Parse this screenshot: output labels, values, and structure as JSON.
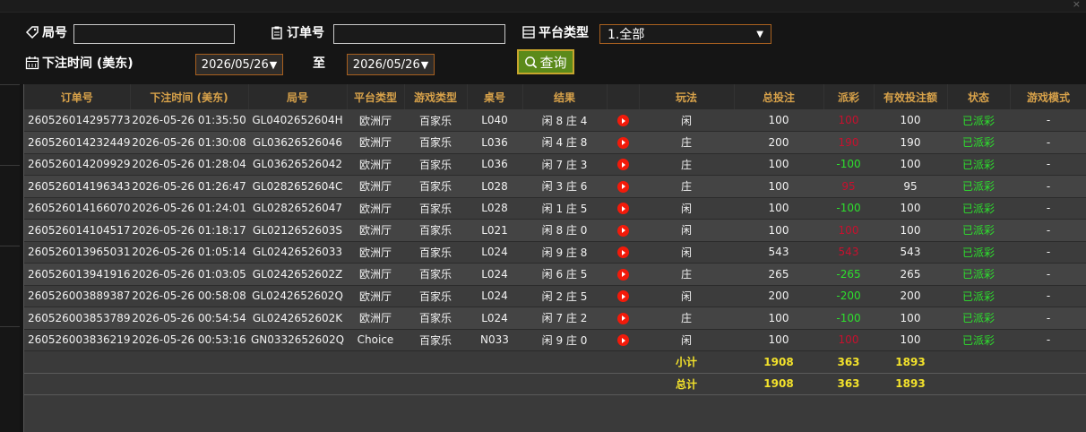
{
  "filters": {
    "round_label": "局号",
    "round_value": "",
    "order_label": "订单号",
    "order_value": "",
    "platform_label": "平台类型",
    "platform_selected": "1.全部",
    "time_label": "下注时间 (美东)",
    "date_from": "2026/05/26",
    "to_label": "至",
    "date_to": "2026/05/26",
    "query_label": "查询"
  },
  "table": {
    "headers": [
      "订单号",
      "下注时间 (美东)",
      "局号",
      "平台类型",
      "游戏类型",
      "桌号",
      "结果",
      "",
      "玩法",
      "总投注",
      "派彩",
      "有效投注额",
      "状态",
      "游戏模式"
    ],
    "rows": [
      {
        "order": "260526014295773",
        "time": "2026-05-26 01:35:50",
        "round": "GL0402652604H",
        "platform": "欧洲厅",
        "game": "百家乐",
        "table": "L040",
        "result": "闲 8 庄 4",
        "bet": "闲",
        "total": "100",
        "payout": "100",
        "payout_color": "red",
        "valid": "100",
        "status": "已派彩",
        "mode": "-"
      },
      {
        "order": "260526014232449",
        "time": "2026-05-26 01:30:08",
        "round": "GL03626526046",
        "platform": "欧洲厅",
        "game": "百家乐",
        "table": "L036",
        "result": "闲 4 庄 8",
        "bet": "庄",
        "total": "200",
        "payout": "190",
        "payout_color": "red",
        "valid": "190",
        "status": "已派彩",
        "mode": "-"
      },
      {
        "order": "260526014209929",
        "time": "2026-05-26 01:28:04",
        "round": "GL03626526042",
        "platform": "欧洲厅",
        "game": "百家乐",
        "table": "L036",
        "result": "闲 7 庄 3",
        "bet": "庄",
        "total": "100",
        "payout": "-100",
        "payout_color": "green",
        "valid": "100",
        "status": "已派彩",
        "mode": "-"
      },
      {
        "order": "260526014196343",
        "time": "2026-05-26 01:26:47",
        "round": "GL0282652604C",
        "platform": "欧洲厅",
        "game": "百家乐",
        "table": "L028",
        "result": "闲 3 庄 6",
        "bet": "庄",
        "total": "100",
        "payout": "95",
        "payout_color": "red",
        "valid": "95",
        "status": "已派彩",
        "mode": "-"
      },
      {
        "order": "260526014166070",
        "time": "2026-05-26 01:24:01",
        "round": "GL02826526047",
        "platform": "欧洲厅",
        "game": "百家乐",
        "table": "L028",
        "result": "闲 1 庄 5",
        "bet": "闲",
        "total": "100",
        "payout": "-100",
        "payout_color": "green",
        "valid": "100",
        "status": "已派彩",
        "mode": "-"
      },
      {
        "order": "260526014104517",
        "time": "2026-05-26 01:18:17",
        "round": "GL0212652603S",
        "platform": "欧洲厅",
        "game": "百家乐",
        "table": "L021",
        "result": "闲 8 庄 0",
        "bet": "闲",
        "total": "100",
        "payout": "100",
        "payout_color": "red",
        "valid": "100",
        "status": "已派彩",
        "mode": "-"
      },
      {
        "order": "260526013965031",
        "time": "2026-05-26 01:05:14",
        "round": "GL02426526033",
        "platform": "欧洲厅",
        "game": "百家乐",
        "table": "L024",
        "result": "闲 9 庄 8",
        "bet": "闲",
        "total": "543",
        "payout": "543",
        "payout_color": "red",
        "valid": "543",
        "status": "已派彩",
        "mode": "-"
      },
      {
        "order": "260526013941916",
        "time": "2026-05-26 01:03:05",
        "round": "GL0242652602Z",
        "platform": "欧洲厅",
        "game": "百家乐",
        "table": "L024",
        "result": "闲 6 庄 5",
        "bet": "庄",
        "total": "265",
        "payout": "-265",
        "payout_color": "green",
        "valid": "265",
        "status": "已派彩",
        "mode": "-"
      },
      {
        "order": "260526003889387",
        "time": "2026-05-26 00:58:08",
        "round": "GL0242652602Q",
        "platform": "欧洲厅",
        "game": "百家乐",
        "table": "L024",
        "result": "闲 2 庄 5",
        "bet": "闲",
        "total": "200",
        "payout": "-200",
        "payout_color": "green",
        "valid": "200",
        "status": "已派彩",
        "mode": "-"
      },
      {
        "order": "260526003853789",
        "time": "2026-05-26 00:54:54",
        "round": "GL0242652602K",
        "platform": "欧洲厅",
        "game": "百家乐",
        "table": "L024",
        "result": "闲 7 庄 2",
        "bet": "庄",
        "total": "100",
        "payout": "-100",
        "payout_color": "green",
        "valid": "100",
        "status": "已派彩",
        "mode": "-"
      },
      {
        "order": "260526003836219",
        "time": "2026-05-26 00:53:16",
        "round": "GN0332652602Q",
        "platform": "Choice",
        "game": "百家乐",
        "table": "N033",
        "result": "闲 9 庄 0",
        "bet": "闲",
        "total": "100",
        "payout": "100",
        "payout_color": "red",
        "valid": "100",
        "status": "已派彩",
        "mode": "-"
      }
    ],
    "subtotal": {
      "label": "小计",
      "total": "1908",
      "payout": "363",
      "valid": "1893"
    },
    "grandtotal": {
      "label": "总计",
      "total": "1908",
      "payout": "363",
      "valid": "1893"
    }
  },
  "colors": {
    "red": "#c8102e",
    "green": "#2de02d",
    "header": "#d8a24a",
    "total": "#f3e22b",
    "accent": "#a8601f"
  },
  "icons": {
    "round": "tag-icon",
    "order": "clipboard-icon",
    "platform": "list-icon",
    "time": "calendar-icon",
    "query": "search-icon",
    "result": "play-icon"
  }
}
